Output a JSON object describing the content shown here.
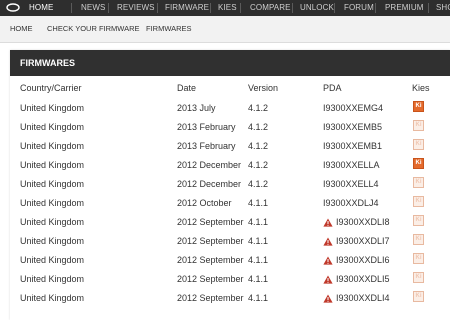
{
  "topnav": {
    "items": [
      {
        "label": "HOME",
        "active": true
      },
      {
        "label": "NEWS",
        "active": false
      },
      {
        "label": "REVIEWS",
        "active": false
      },
      {
        "label": "FIRMWARE",
        "active": false
      },
      {
        "label": "KIES",
        "active": false
      },
      {
        "label": "COMPARE",
        "active": false
      },
      {
        "label": "UNLOCK",
        "active": false
      },
      {
        "label": "FORUM",
        "active": false
      },
      {
        "label": "PREMIUM",
        "active": false
      },
      {
        "label": "SHO",
        "active": false
      }
    ]
  },
  "subnav": {
    "items": [
      "HOME",
      "CHECK YOUR FIRMWARE",
      "FIRMWARES"
    ]
  },
  "panel": {
    "title": "FIRMWARES",
    "columns": [
      "Country/Carrier",
      "Date",
      "Version",
      "PDA",
      "Kies"
    ]
  },
  "rows": [
    {
      "country": "United Kingdom",
      "date": "2013 July",
      "version": "4.1.2",
      "pda": "I9300XXEMG4",
      "warning": false,
      "kies": true
    },
    {
      "country": "United Kingdom",
      "date": "2013 February",
      "version": "4.1.2",
      "pda": "I9300XXEMB5",
      "warning": false,
      "kies": false
    },
    {
      "country": "United Kingdom",
      "date": "2013 February",
      "version": "4.1.2",
      "pda": "I9300XXEMB1",
      "warning": false,
      "kies": false
    },
    {
      "country": "United Kingdom",
      "date": "2012 December",
      "version": "4.1.2",
      "pda": "I9300XXELLA",
      "warning": false,
      "kies": true
    },
    {
      "country": "United Kingdom",
      "date": "2012 December",
      "version": "4.1.2",
      "pda": "I9300XXELL4",
      "warning": false,
      "kies": false
    },
    {
      "country": "United Kingdom",
      "date": "2012 October",
      "version": "4.1.1",
      "pda": "I9300XXDLJ4",
      "warning": false,
      "kies": false
    },
    {
      "country": "United Kingdom",
      "date": "2012 September",
      "version": "4.1.1",
      "pda": "I9300XXDLI8",
      "warning": true,
      "kies": false
    },
    {
      "country": "United Kingdom",
      "date": "2012 September",
      "version": "4.1.1",
      "pda": "I9300XXDLI7",
      "warning": true,
      "kies": false
    },
    {
      "country": "United Kingdom",
      "date": "2012 September",
      "version": "4.1.1",
      "pda": "I9300XXDLI6",
      "warning": true,
      "kies": false
    },
    {
      "country": "United Kingdom",
      "date": "2012 September",
      "version": "4.1.1",
      "pda": "I9300XXDLI5",
      "warning": true,
      "kies": false
    },
    {
      "country": "United Kingdom",
      "date": "2012 September",
      "version": "4.1.1",
      "pda": "I9300XXDLI4",
      "warning": true,
      "kies": false
    }
  ],
  "kies_badge": "Ki",
  "colors": {
    "topbar": "#2e2e2e",
    "panel_header": "#303030",
    "kies_active": "#e46a2c",
    "warning": "#c0392b"
  },
  "icons": {
    "logo": "site-logo",
    "warning": "warning-icon",
    "kies": "kies-icon"
  }
}
